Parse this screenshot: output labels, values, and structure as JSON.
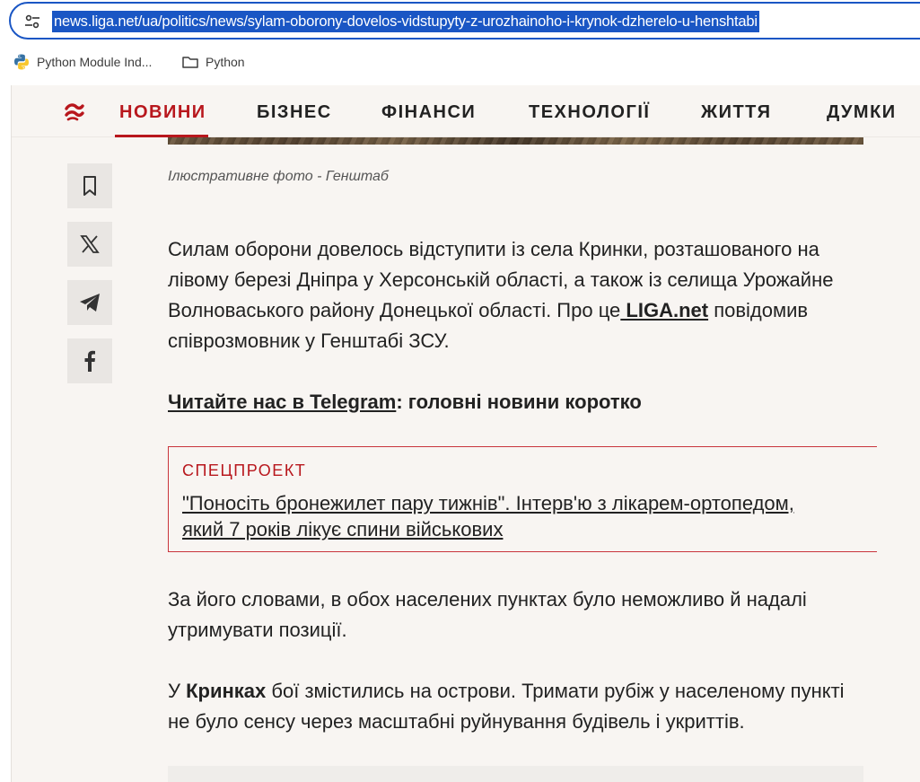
{
  "browser": {
    "url": "news.liga.net/ua/politics/news/sylam-oborony-dovelos-vidstupyty-z-urozhainoho-i-krynok-dzherelo-u-henshtabi",
    "bookmarks": [
      {
        "label": "Python Module Ind...",
        "icon": "python-icon"
      },
      {
        "label": "Python",
        "icon": "folder-icon"
      }
    ]
  },
  "nav": {
    "items": [
      "НОВИНИ",
      "БІЗНЕС",
      "ФІНАНСИ",
      "ТЕХНОЛОГІЇ",
      "ЖИТТЯ",
      "ДУМКИ"
    ],
    "active": "НОВИНИ",
    "accent": "#b8171d"
  },
  "article": {
    "caption": "Ілюстративне фото - Генштаб",
    "p1_text": "Силам оборони довелось відступити із села Кринки, розташованого на лівому березі Дніпра у Херсонській області, а також із селища Урожайне Волноваського району Донецької області. Про це",
    "p1_link": " LIGA.net",
    "p1_tail": " повідомив співрозмовник у Генштабі ЗСУ.",
    "telegram_link": "Читайте нас в Telegram",
    "telegram_tail": ": головні новини коротко",
    "special_label": "СПЕЦПРОЕКТ",
    "special_title": "\"Поносіть бронежилет пару тижнів\". Інтерв'ю з лікарем-ортопедом, який 7 років лікує спини військових",
    "p2": "За його словами, в обох населених пунктах було неможливо й надалі утримувати позиції.",
    "p3_pre": "У ",
    "p3_bold": "Кринках",
    "p3_tail": " бої змістились на острови. Тримати рубіж у населеному пункті не було сенсу через масштабні руйнування будівель і укриттів."
  },
  "share": [
    "bookmark-icon",
    "x-icon",
    "telegram-icon",
    "facebook-icon"
  ]
}
